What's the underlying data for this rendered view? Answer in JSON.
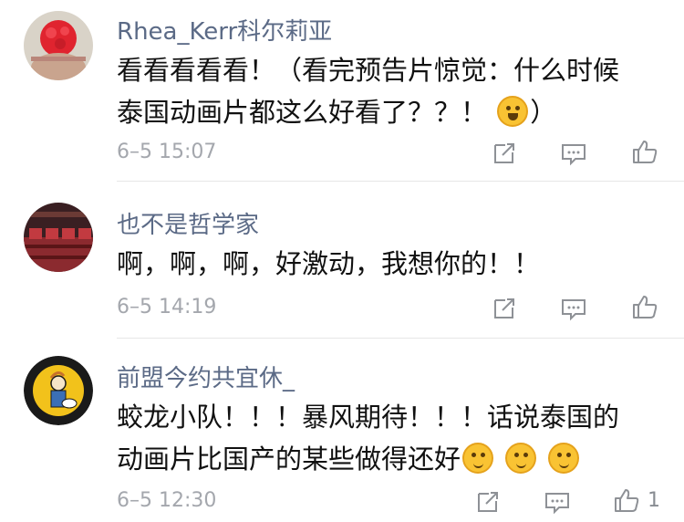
{
  "comments": [
    {
      "username": "Rhea_Kerr科尔莉亚",
      "lines": [
        "看看看看看！（看完预告片惊觉：什么时候",
        "泰国动画片都这么好看了？？！"
      ],
      "line2_suffix": "）",
      "emoji": "face-with-tears-of-joy",
      "time": "6–5 15:07",
      "likes": ""
    },
    {
      "username": "也不是哲学家",
      "lines": [
        "啊，啊，啊，好激动，我想你的！！"
      ],
      "time": "6–5 14:19",
      "likes": ""
    },
    {
      "username": "前盟今约共宜休_",
      "lines": [
        "蛟龙小队！！！暴风期待！！！话说泰国的",
        "动画片比国产的某些做得还好"
      ],
      "emoji": "thinking-face",
      "time": "6–5 12:30",
      "likes": "1"
    }
  ],
  "colors": {
    "username": "#5b6a86",
    "text": "#111111",
    "time": "#a4a7ad",
    "icon": "#8e9196"
  }
}
